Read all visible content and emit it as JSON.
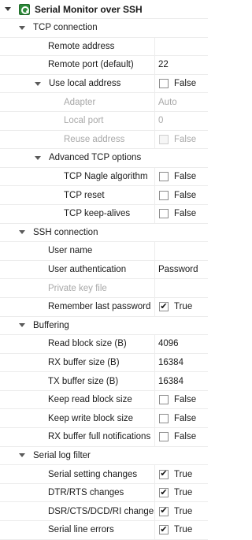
{
  "title": "Serial Monitor over SSH",
  "rows": [
    {
      "kind": "group",
      "level": 1,
      "label": "TCP connection"
    },
    {
      "kind": "prop",
      "level": 2,
      "label": "Remote address",
      "value": ""
    },
    {
      "kind": "prop",
      "level": 2,
      "label": "Remote port (default)",
      "value": "22"
    },
    {
      "kind": "bool",
      "level": 2,
      "label": "Use local address",
      "value": "False",
      "checked": false,
      "expandable": true
    },
    {
      "kind": "prop",
      "level": 3,
      "label": "Adapter",
      "value": "Auto",
      "disabled": true
    },
    {
      "kind": "prop",
      "level": 3,
      "label": "Local port",
      "value": "0",
      "disabled": true
    },
    {
      "kind": "bool",
      "level": 3,
      "label": "Reuse address",
      "value": "False",
      "checked": false,
      "disabled": true
    },
    {
      "kind": "group",
      "level": 2,
      "label": "Advanced TCP options"
    },
    {
      "kind": "bool",
      "level": 3,
      "label": "TCP Nagle algorithm",
      "value": "False",
      "checked": false
    },
    {
      "kind": "bool",
      "level": 3,
      "label": "TCP reset",
      "value": "False",
      "checked": false
    },
    {
      "kind": "bool",
      "level": 3,
      "label": "TCP keep-alives",
      "value": "False",
      "checked": false
    },
    {
      "kind": "group",
      "level": 1,
      "label": "SSH connection"
    },
    {
      "kind": "prop",
      "level": 2,
      "label": "User name",
      "value": ""
    },
    {
      "kind": "prop",
      "level": 2,
      "label": "User authentication",
      "value": "Password"
    },
    {
      "kind": "prop",
      "level": 2,
      "label": "Private key file",
      "value": "",
      "disabled": true
    },
    {
      "kind": "bool",
      "level": 2,
      "label": "Remember last password",
      "value": "True",
      "checked": true
    },
    {
      "kind": "group",
      "level": 1,
      "label": "Buffering"
    },
    {
      "kind": "prop",
      "level": 2,
      "label": "Read block size (B)",
      "value": "4096"
    },
    {
      "kind": "prop",
      "level": 2,
      "label": "RX buffer size (B)",
      "value": "16384"
    },
    {
      "kind": "prop",
      "level": 2,
      "label": "TX buffer size (B)",
      "value": "16384"
    },
    {
      "kind": "bool",
      "level": 2,
      "label": "Keep read block size",
      "value": "False",
      "checked": false
    },
    {
      "kind": "bool",
      "level": 2,
      "label": "Keep write block size",
      "value": "False",
      "checked": false
    },
    {
      "kind": "bool",
      "level": 2,
      "label": "RX buffer full notifications",
      "value": "False",
      "checked": false
    },
    {
      "kind": "group",
      "level": 1,
      "label": "Serial log filter"
    },
    {
      "kind": "bool",
      "level": 2,
      "label": "Serial setting changes",
      "value": "True",
      "checked": true
    },
    {
      "kind": "bool",
      "level": 2,
      "label": "DTR/RTS changes",
      "value": "True",
      "checked": true
    },
    {
      "kind": "bool",
      "level": 2,
      "label": "DSR/CTS/DCD/RI changes",
      "value": "True",
      "checked": true
    },
    {
      "kind": "bool",
      "level": 2,
      "label": "Serial line errors",
      "value": "True",
      "checked": true
    }
  ]
}
